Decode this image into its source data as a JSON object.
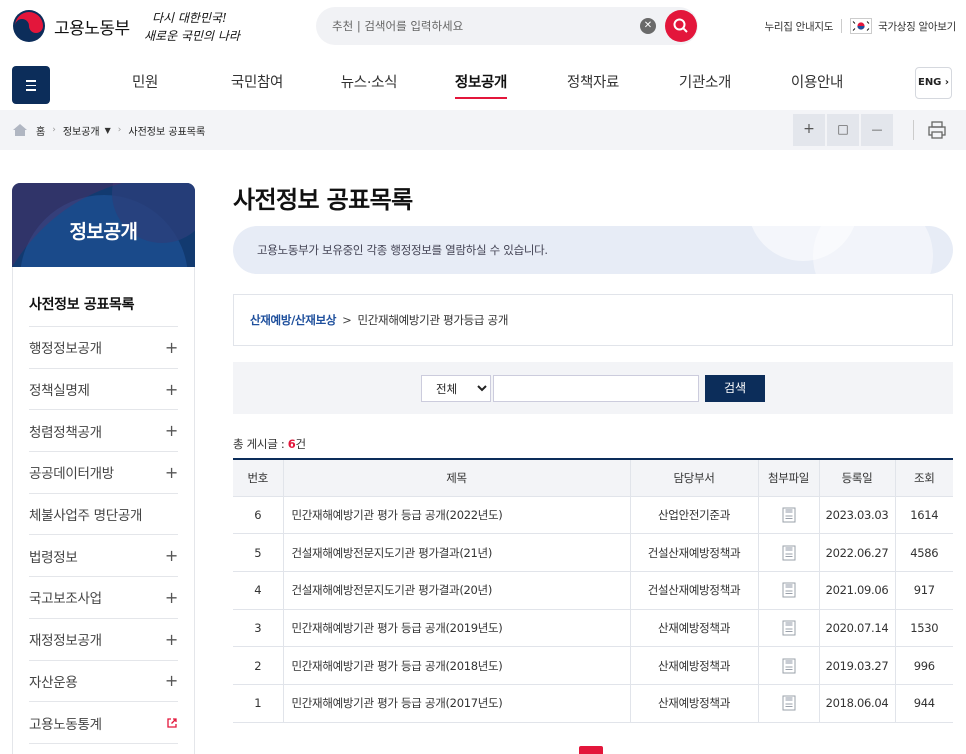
{
  "header": {
    "ministry_name": "고용노동부",
    "slogan_line1": "다시 대한민국!",
    "slogan_line2": "새로운 국민의 나라",
    "search_placeholder": "추천 | 검색어를 입력하세요",
    "util_links": [
      "누리집 안내지도",
      "국가상징 알아보기"
    ]
  },
  "gnb": {
    "items": [
      "민원",
      "국민참여",
      "뉴스·소식",
      "정보공개",
      "정책자료",
      "기관소개",
      "이용안내"
    ],
    "active_index": 3,
    "eng_label": "ENG"
  },
  "breadcrumb": {
    "home": "홈",
    "level1": "정보공개",
    "level2": "사전정보 공표목록"
  },
  "tools": {
    "zoom_in": "+",
    "reset": "□",
    "zoom_out": "—"
  },
  "sidebar": {
    "title": "정보공개",
    "items": [
      {
        "label": "사전정보 공표목록",
        "marker": ""
      },
      {
        "label": "행정정보공개",
        "marker": "+"
      },
      {
        "label": "정책실명제",
        "marker": "+"
      },
      {
        "label": "청렴정책공개",
        "marker": "+"
      },
      {
        "label": "공공데이터개방",
        "marker": "+"
      },
      {
        "label": "체불사업주 명단공개",
        "marker": ""
      },
      {
        "label": "법령정보",
        "marker": "+"
      },
      {
        "label": "국고보조사업",
        "marker": "+"
      },
      {
        "label": "재정정보공개",
        "marker": "+"
      },
      {
        "label": "자산운용",
        "marker": "+"
      },
      {
        "label": "고용노동통계",
        "marker": "external"
      }
    ]
  },
  "content": {
    "title": "사전정보 공표목록",
    "intro": "고용노동부가 보유중인 각종 행정정보를 열람하실 수 있습니다.",
    "path_category": "산재예방/산재보상",
    "path_sep": ">",
    "path_item": "민간재해예방기관 평가등급 공개",
    "filter_option": "전체",
    "search_button": "검색",
    "total_label": "총 게시글 : ",
    "total_count": "6",
    "total_unit": "건"
  },
  "table": {
    "headers": [
      "번호",
      "제목",
      "담당부서",
      "첨부파일",
      "등록일",
      "조회"
    ],
    "rows": [
      {
        "no": "6",
        "title": "민간재해예방기관 평가 등급 공개(2022년도)",
        "dept": "산업안전기준과",
        "date": "2023.03.03",
        "views": "1614"
      },
      {
        "no": "5",
        "title": "건설재해예방전문지도기관 평가결과(21년)",
        "dept": "건설산재예방정책과",
        "date": "2022.06.27",
        "views": "4586"
      },
      {
        "no": "4",
        "title": "건설재해예방전문지도기관 평가결과(20년)",
        "dept": "건설산재예방정책과",
        "date": "2021.09.06",
        "views": "917"
      },
      {
        "no": "3",
        "title": "민간재해예방기관 평가 등급 공개(2019년도)",
        "dept": "산재예방정책과",
        "date": "2020.07.14",
        "views": "1530"
      },
      {
        "no": "2",
        "title": "민간재해예방기관 평가 등급 공개(2018년도)",
        "dept": "산재예방정책과",
        "date": "2019.03.27",
        "views": "996"
      },
      {
        "no": "1",
        "title": "민간재해예방기관 평가 등급 공개(2017년도)",
        "dept": "산재예방정책과",
        "date": "2018.06.04",
        "views": "944"
      }
    ]
  },
  "colors": {
    "navy": "#0c2d5a",
    "accent_red": "#e3163b",
    "link_blue": "#1e4f9c"
  }
}
